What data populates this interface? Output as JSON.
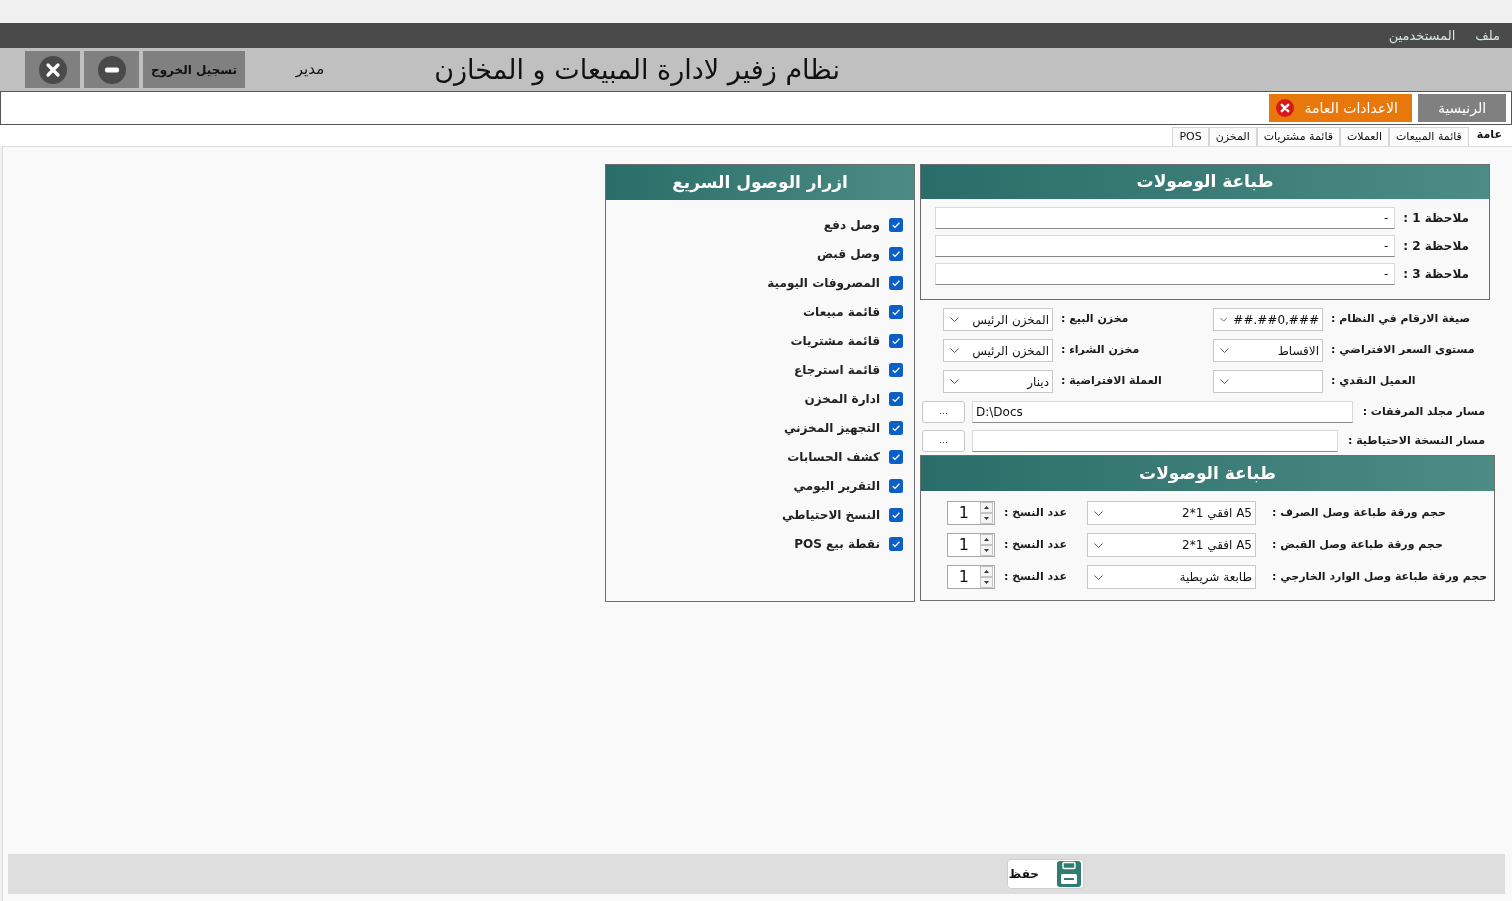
{
  "menu_bar": {
    "items": [
      {
        "label": "ملف"
      },
      {
        "label": "المستخدمين"
      }
    ]
  },
  "header": {
    "title": "نظام زفير لادارة المبيعات و المخازن",
    "user_role": "مدير",
    "logout_button": "تسجيل الخروج"
  },
  "main_tabs": [
    {
      "label": "الرنيسية",
      "selected": false,
      "closable": false
    },
    {
      "label": "الاعدادات العامة",
      "selected": true,
      "closable": true
    }
  ],
  "sub_tabs": [
    {
      "label": "عامة",
      "selected": true
    },
    {
      "label": "قائمة المبيعات",
      "selected": false
    },
    {
      "label": "العملات",
      "selected": false
    },
    {
      "label": "قائمة مشتريات",
      "selected": false
    },
    {
      "label": "المخزن",
      "selected": false
    },
    {
      "label": "POS",
      "selected": false
    }
  ],
  "notes_panel": {
    "title": "طباعة الوصولات",
    "notes": [
      {
        "label": "ملاحظة 1 :",
        "value": "-"
      },
      {
        "label": "ملاحظة 2 :",
        "value": "-"
      },
      {
        "label": "ملاحظة 3 :",
        "value": "-"
      }
    ]
  },
  "settings": {
    "rows": [
      {
        "fields": [
          {
            "label": "صيغة الارقام في النظام :",
            "value": "###,##0.##"
          },
          {
            "label": "مخزن البيع :",
            "value": "المخزن الرئيس"
          }
        ]
      },
      {
        "fields": [
          {
            "label": "مستوى السعر الافتراضي :",
            "value": "الاقساط"
          },
          {
            "label": "مخزن الشراء :",
            "value": "المخزن الرئيس"
          }
        ]
      },
      {
        "fields": [
          {
            "label": "العميل النقدي :"
          },
          {
            "label": "العملة الافتراضية :",
            "value": "دينار"
          }
        ]
      }
    ]
  },
  "paths": [
    {
      "label": "مسار مجلد المرفقات :",
      "value": "D:\\Docs",
      "button": "..."
    },
    {
      "label": "مسار النسخة الاحتياطية :",
      "button": "..."
    }
  ],
  "print_panel": {
    "title": "طباعة الوصولات",
    "rows": [
      {
        "label": "حجم ورقة طباعة وصل الصرف :",
        "paper": "A5 افقي 1*2",
        "copies_label": "عدد النسخ :",
        "copies": "1"
      },
      {
        "label": "حجم ورقة طباعة وصل القبض :",
        "paper": "A5 افقي 1*2",
        "copies_label": "عدد النسخ :",
        "copies": "1"
      },
      {
        "label": "حجم ورقة طباعة وصل الوارد الخارجي :",
        "paper": "طابعة شريطية",
        "copies_label": "عدد النسخ :",
        "copies": "1"
      }
    ]
  },
  "quick_access": {
    "title": "ازرار الوصول السريع",
    "items": [
      {
        "label": "وصل دفع",
        "checked": true
      },
      {
        "label": "وصل قبض",
        "checked": true
      },
      {
        "label": "المصروفات اليومية",
        "checked": true
      },
      {
        "label": "قائمة مبيعات",
        "checked": true
      },
      {
        "label": "قائمة مشتريات",
        "checked": true
      },
      {
        "label": "قائمة استرجاع",
        "checked": true
      },
      {
        "label": "ادارة المخزن",
        "checked": true
      },
      {
        "label": "التجهيز المخزني",
        "checked": true
      },
      {
        "label": "كشف الحسابات",
        "checked": true
      },
      {
        "label": "التقرير اليومي",
        "checked": true
      },
      {
        "label": "النسخ الاحتياطي",
        "checked": true
      },
      {
        "label": "نقطة بيع POS",
        "checked": true
      }
    ]
  },
  "footer": {
    "save_button": "حفظ"
  }
}
